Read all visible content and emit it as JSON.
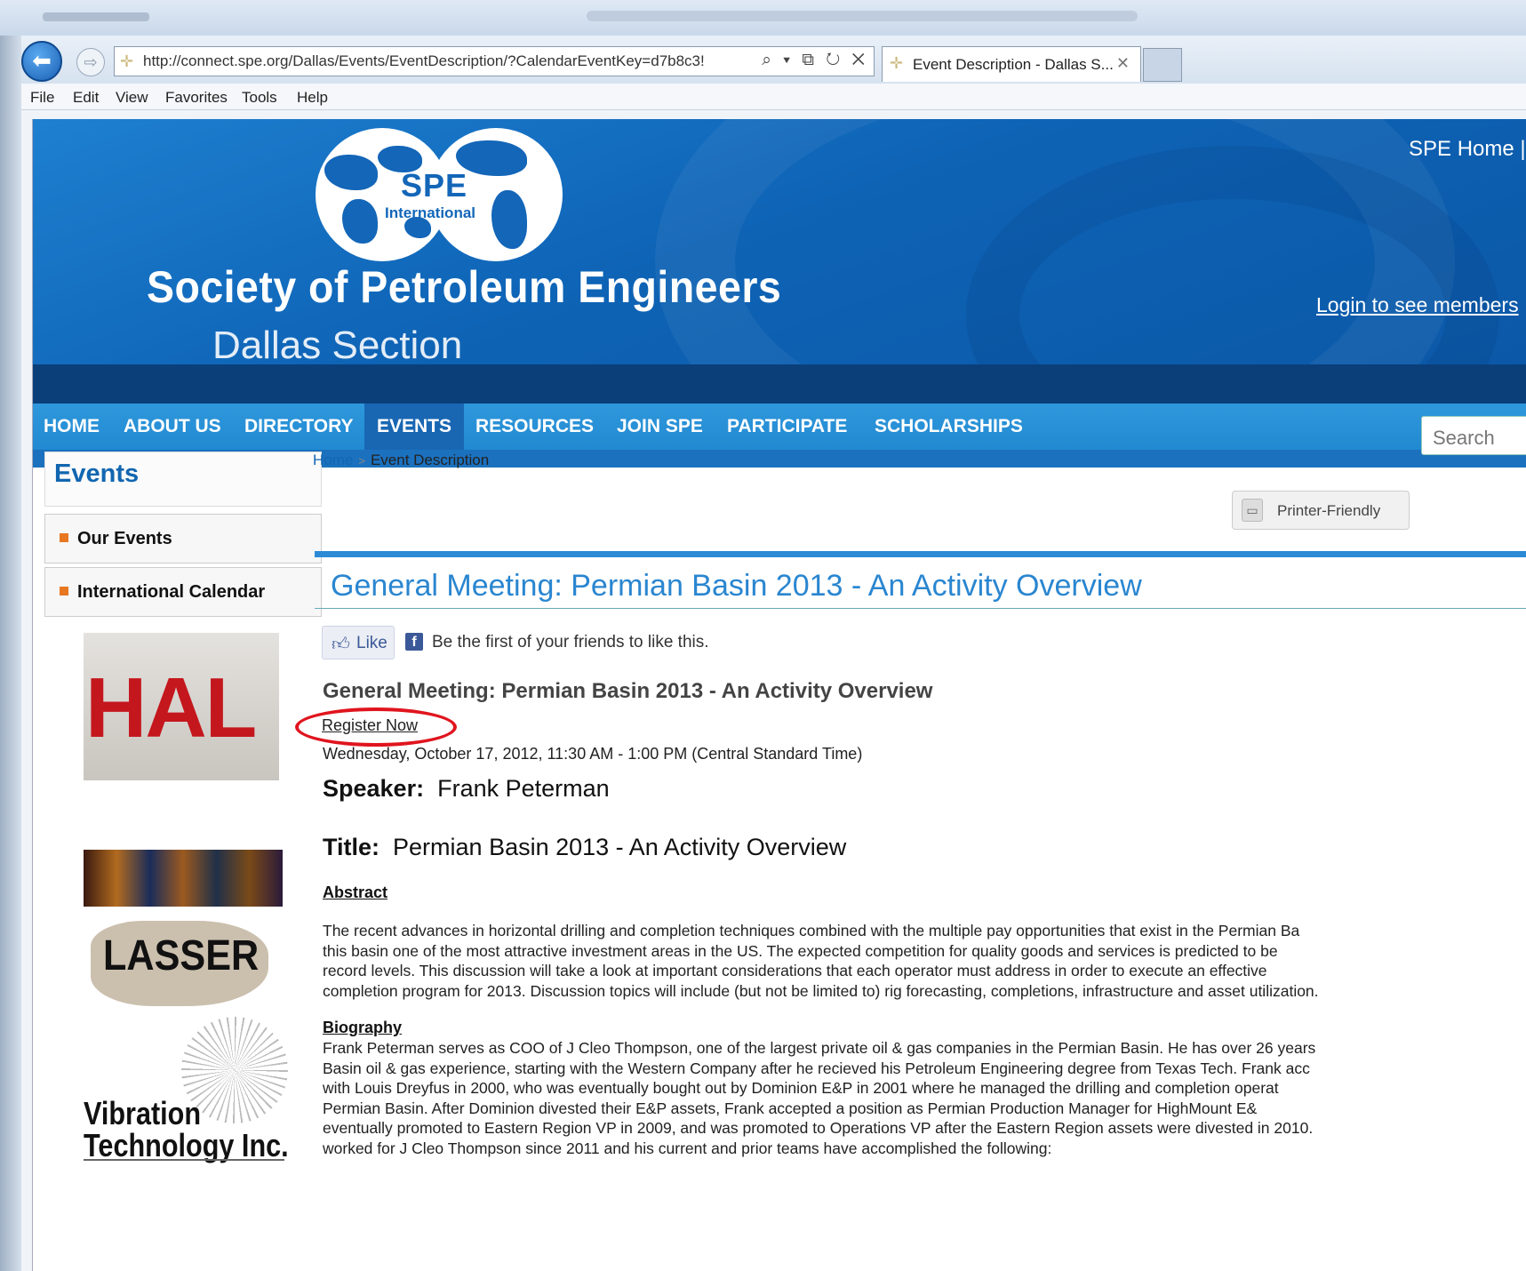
{
  "browser": {
    "url": "http://connect.spe.org/Dallas/Events/EventDescription/?CalendarEventKey=d7b8c3!",
    "url_tools": "⌕ ▾ ⧉ ↻ ✕",
    "tab_label": "Event Description - Dallas S...",
    "back_glyph": "⬅",
    "forward_glyph": "⇨",
    "menu": [
      "File",
      "Edit",
      "View",
      "Favorites",
      "Tools",
      "Help"
    ]
  },
  "header": {
    "logo_text": "SPE",
    "logo_sub": "International",
    "org_name": "Society of Petroleum Engineers",
    "section_name": "Dallas Section",
    "spe_home": "SPE Home |",
    "login_link": "Login to see members"
  },
  "nav": {
    "items": [
      "HOME",
      "ABOUT US",
      "DIRECTORY",
      "EVENTS",
      "RESOURCES",
      "JOIN SPE",
      "PARTICIPATE",
      "SCHOLARSHIPS"
    ],
    "active": "EVENTS",
    "search_placeholder": "Search"
  },
  "sidebar": {
    "title": "Events",
    "items": [
      "Our Events",
      "International Calendar"
    ],
    "sponsors": [
      "HAL",
      "LASSER",
      "Vibration",
      "Technology Inc."
    ]
  },
  "breadcrumb": {
    "home": "Home",
    "separator": ">",
    "current": "Event Description"
  },
  "printer": {
    "label": "Printer-Friendly"
  },
  "event": {
    "page_title": "General Meeting: Permian Basin 2013 - An Activity Overview",
    "like_label": "Like",
    "fb_text": "Be the first of your friends to like this.",
    "heading": "General Meeting: Permian Basin 2013 - An Activity Overview",
    "register": "Register Now",
    "datetime": "Wednesday, October 17, 2012, 11:30 AM - 1:00 PM (Central Standard Time)",
    "speaker_label": "Speaker:",
    "speaker_name": "Frank Peterman",
    "title_label": "Title:",
    "title_value": "Permian Basin 2013 - An Activity Overview",
    "abstract_label": "Abstract",
    "abstract_lines": [
      "The recent advances in horizontal drilling and completion techniques combined with the multiple pay opportunities that exist in the Permian Ba",
      "this basin one of the most attractive investment areas in the US.  The expected competition for quality goods and services is predicted to be",
      "record levels.  This discussion will take a look at important considerations that each operator must address in order to execute an effective",
      "completion program for 2013.  Discussion topics will include (but not be limited to) rig forecasting, completions, infrastructure and asset utilization."
    ],
    "bio_label": "Biography",
    "bio_lines": [
      "Frank Peterman serves as COO of J Cleo Thompson, one of the largest private oil & gas companies in the Permian Basin.  He has over 26 years",
      "Basin oil & gas experience, starting with the Western Company after he recieved his Petroleum Engineering degree from Texas Tech.  Frank acc",
      "with Louis Dreyfus in 2000, who was eventually bought out by Dominion E&P in 2001 where he managed the drilling and completion operat",
      "Permian Basin.  After Dominion divested their E&P assets, Frank accepted a position as Permian Production Manager for HighMount E&",
      "eventually promoted to Eastern Region VP in 2009, and was promoted to Operations VP after the Eastern Region assets were divested in 2010.",
      "worked for J Cleo Thompson since 2011 and his current and prior teams have accomplished the following:"
    ]
  }
}
